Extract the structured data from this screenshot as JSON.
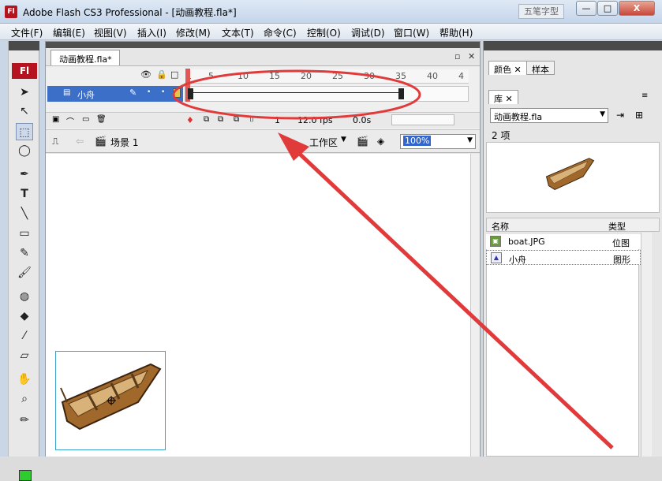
{
  "window": {
    "title": "Adobe Flash CS3 Professional - [动画教程.fla*]",
    "watermark": "五笔字型",
    "min_label": "—",
    "max_label": "□",
    "close_label": "X"
  },
  "menu": [
    "文件(F)",
    "编辑(E)",
    "视图(V)",
    "插入(I)",
    "修改(M)",
    "文本(T)",
    "命令(C)",
    "控制(O)",
    "调试(D)",
    "窗口(W)",
    "帮助(H)"
  ],
  "tools": {
    "badge": "Fl"
  },
  "document": {
    "tab": "动画教程.fla*",
    "restore": "▫",
    "close": "✕"
  },
  "timeline": {
    "ruler": [
      "1",
      "5",
      "10",
      "15",
      "20",
      "25",
      "30",
      "35",
      "40",
      "4"
    ],
    "layer": "小舟",
    "current_frame": "1",
    "fps": "12.0 fps",
    "time": "0.0s"
  },
  "editbar": {
    "scene": "场景 1",
    "workspace": "工作区",
    "zoom": "100%"
  },
  "colors": {
    "selection": "#3c6fc8",
    "annotation": "#e03a3a",
    "brand": "#b4131f"
  },
  "panels": {
    "tabs_top": [
      "颜色",
      "样本"
    ],
    "library_tab": "库",
    "library_file": "动画教程.fla",
    "item_count": "2 项",
    "columns": {
      "name": "名称",
      "type": "类型"
    },
    "items": [
      {
        "name": "boat.JPG",
        "type": "位图"
      },
      {
        "name": "小舟",
        "type": "图形"
      }
    ]
  }
}
